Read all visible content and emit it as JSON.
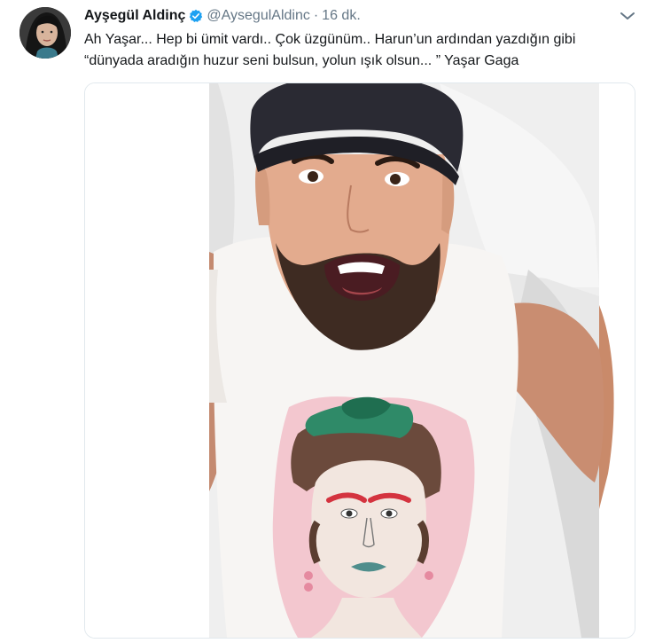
{
  "tweet": {
    "author": {
      "display_name": "Ayşegül Aldinç",
      "handle": "@AysegulAldinc",
      "verified": true,
      "avatar_icon": "profile-photo"
    },
    "separator": "·",
    "timestamp": "16 dk.",
    "text_lines": [
      "Ah Yaşar... Hep bi ümit vardı.. Çok üzgünüm..  Harun’un ardından yazdığın gibi",
      "“dünyada aradığın huzur seni bulsun, yolun ışık olsun... ” Yaşar Gaga"
    ],
    "media": {
      "type": "photo"
    },
    "menu_icon": "chevron-down-icon"
  },
  "colors": {
    "text_primary": "#14171a",
    "text_secondary": "#657786",
    "verified_blue": "#1da1f2",
    "border": "#e1e8ed"
  }
}
